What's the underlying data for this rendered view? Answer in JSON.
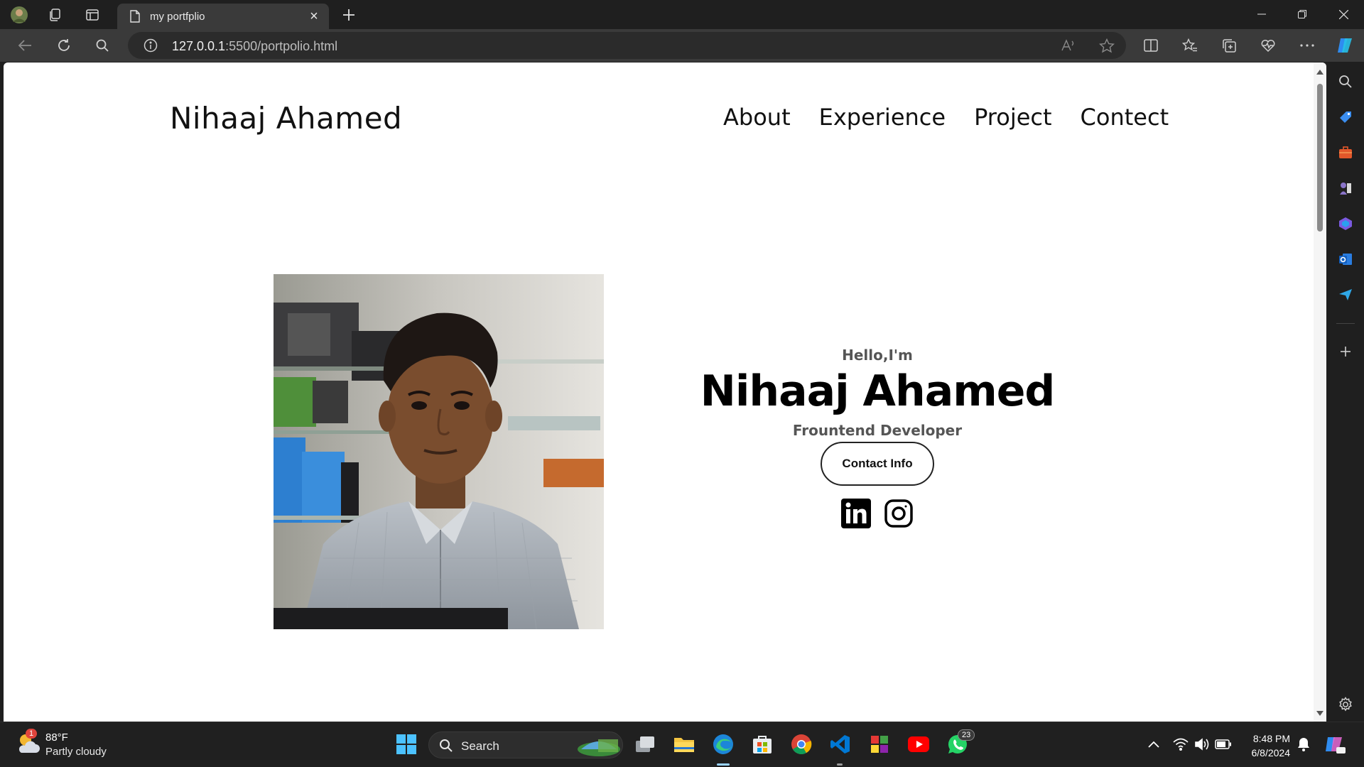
{
  "browser": {
    "tab_title": "my portfplio",
    "url_host": "127.0.0.1",
    "url_rest": ":5500/portpolio.html"
  },
  "site": {
    "logo": "Nihaaj Ahamed",
    "nav": [
      "About",
      "Experience",
      "Project",
      "Contect"
    ],
    "greeting": "Hello,I'm",
    "name": "Nihaaj Ahamed",
    "role": "Frountend Developer",
    "contact_button": "Contact Info",
    "socials": [
      "linkedin-icon",
      "instagram-icon"
    ]
  },
  "taskbar": {
    "weather_temp": "88°F",
    "weather_desc": "Partly cloudy",
    "weather_badge": "1",
    "search_label": "Search",
    "whatsapp_badge": "23",
    "time": "8:48 PM",
    "date": "6/8/2024"
  },
  "colors": {
    "page_bg": "#ffffff",
    "chrome_bg": "#1f1f1f",
    "toolbar_bg": "#3a3a3a",
    "text": "#111111"
  }
}
